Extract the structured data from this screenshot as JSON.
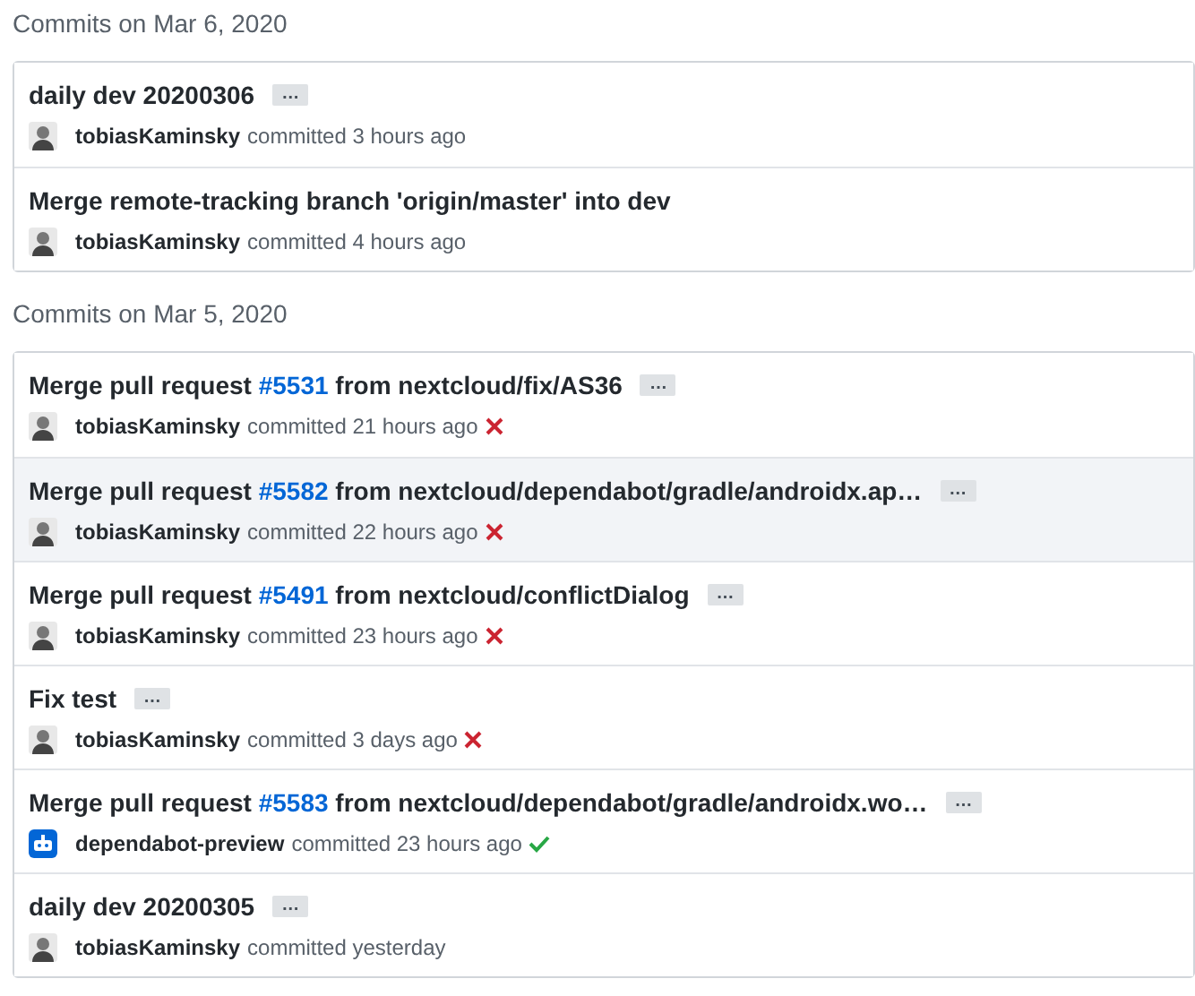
{
  "groups": [
    {
      "heading": "Commits on Mar 6, 2020",
      "commits": [
        {
          "title": [
            {
              "kind": "text",
              "text": "daily dev 20200306"
            }
          ],
          "expander": "…",
          "kind": "person",
          "author": "tobiasKaminsky",
          "meta": "committed 3 hours ago",
          "failed": false,
          "passed": false,
          "highlighted": false
        },
        {
          "title": [
            {
              "kind": "text",
              "text": "Merge remote-tracking branch 'origin/master' into dev"
            }
          ],
          "kind": "person",
          "author": "tobiasKaminsky",
          "meta": "committed 4 hours ago",
          "failed": false,
          "passed": false,
          "highlighted": false
        }
      ]
    },
    {
      "heading": "Commits on Mar 5, 2020",
      "commits": [
        {
          "title": [
            {
              "kind": "text",
              "text": "Merge pull request "
            },
            {
              "kind": "link",
              "text": "#5531"
            },
            {
              "kind": "text",
              "text": " from nextcloud/fix/AS36"
            }
          ],
          "expander": "…",
          "kind": "person",
          "author": "tobiasKaminsky",
          "meta": "committed 21 hours ago",
          "failed": true,
          "passed": false,
          "highlighted": false
        },
        {
          "title": [
            {
              "kind": "text",
              "text": "Merge pull request "
            },
            {
              "kind": "link",
              "text": "#5582"
            },
            {
              "kind": "text",
              "text": " from nextcloud/dependabot/gradle/androidx.ap…"
            }
          ],
          "expander": "…",
          "kind": "person",
          "author": "tobiasKaminsky",
          "meta": "committed 22 hours ago",
          "failed": true,
          "passed": false,
          "highlighted": true
        },
        {
          "title": [
            {
              "kind": "text",
              "text": "Merge pull request "
            },
            {
              "kind": "link",
              "text": "#5491"
            },
            {
              "kind": "text",
              "text": " from nextcloud/conflictDialog"
            }
          ],
          "expander": "…",
          "kind": "person",
          "author": "tobiasKaminsky",
          "meta": "committed 23 hours ago",
          "failed": true,
          "passed": false,
          "highlighted": false
        },
        {
          "title": [
            {
              "kind": "text",
              "text": "Fix test"
            }
          ],
          "expander": "…",
          "kind": "person",
          "author": "tobiasKaminsky",
          "meta": "committed 3 days ago",
          "failed": true,
          "passed": false,
          "highlighted": false
        },
        {
          "title": [
            {
              "kind": "text",
              "text": "Merge pull request "
            },
            {
              "kind": "link",
              "text": "#5583"
            },
            {
              "kind": "text",
              "text": " from nextcloud/dependabot/gradle/androidx.wo…"
            }
          ],
          "expander": "…",
          "kind": "bot",
          "author": "dependabot-preview",
          "meta": "committed 23 hours ago",
          "failed": false,
          "passed": true,
          "highlighted": false
        },
        {
          "title": [
            {
              "kind": "text",
              "text": "daily dev 20200305"
            }
          ],
          "expander": "…",
          "kind": "person",
          "author": "tobiasKaminsky",
          "meta": "committed yesterday",
          "failed": false,
          "passed": false,
          "highlighted": false
        }
      ]
    }
  ]
}
